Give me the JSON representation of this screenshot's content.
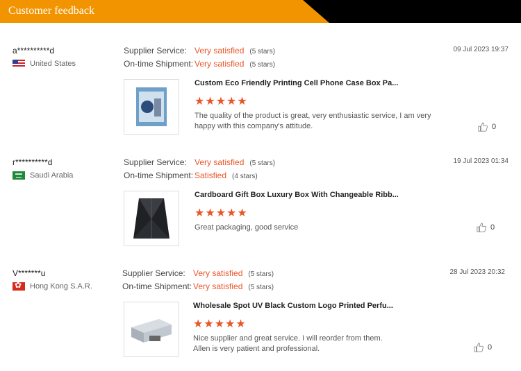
{
  "header": {
    "title": "Customer feedback"
  },
  "colors": {
    "accent": "#f29400",
    "rating": "#e8562a"
  },
  "labels": {
    "supplier_service": "Supplier Service:",
    "ontime_shipment": "On-time Shipment:"
  },
  "reviews": [
    {
      "name": "a**********d",
      "country": "United States",
      "flag_icon": "us-flag-icon",
      "supplier_rating": "Very satisfied",
      "supplier_stars": "(5 stars)",
      "shipment_rating": "Very satisfied",
      "shipment_stars": "(5 stars)",
      "date": "09 Jul 2023 19:37",
      "product": "Custom Eco Friendly Printing Cell Phone Case Box Pa...",
      "stars": "★★★★★",
      "rating": 5,
      "comment": "The quality of the product is great, very enthusiastic service, I am very happy with this company's attitude.",
      "likes": "0"
    },
    {
      "name": "r**********d",
      "country": "Saudi Arabia",
      "flag_icon": "saudi-flag-icon",
      "supplier_rating": "Very satisfied",
      "supplier_stars": "(5 stars)",
      "shipment_rating": "Satisfied",
      "shipment_stars": "(4 stars)",
      "date": "19 Jul 2023 01:34",
      "product": "Cardboard Gift Box Luxury Box With Changeable Ribb...",
      "stars": "★★★★★",
      "rating": 5,
      "comment": "Great packaging, good service",
      "likes": "0"
    },
    {
      "name": "V*******u",
      "country": "Hong Kong S.A.R.",
      "flag_icon": "hong-kong-flag-icon",
      "supplier_rating": "Very satisfied",
      "supplier_stars": "(5 stars)",
      "shipment_rating": "Very satisfied",
      "shipment_stars": "(5 stars)",
      "date": "28 Jul 2023 20:32",
      "product": "Wholesale Spot UV Black Custom Logo Printed Perfu...",
      "stars": "★★★★★",
      "rating": 5,
      "comment": "Nice supplier and great service. I will reorder from them.\nAllen is very patient and professional.",
      "likes": "0"
    }
  ]
}
